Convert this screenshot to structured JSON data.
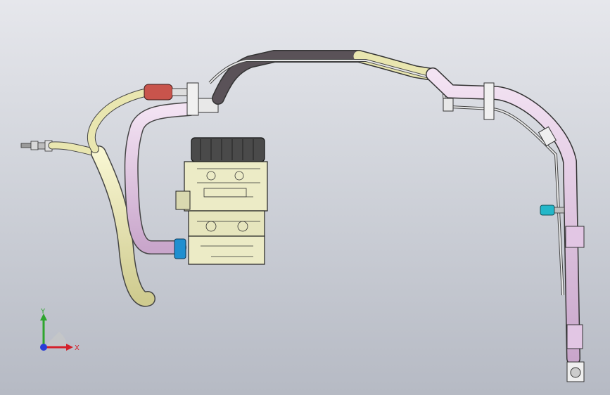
{
  "viewport": {
    "background_top": "#e6e7ec",
    "background_bottom": "#b6bac4"
  },
  "colors": {
    "hose_yellow": "#e9e6b0",
    "tube_pink": "#e2c6e4",
    "tube_dark": "#5a5258",
    "sleeve_red": "#c8544c",
    "fitting_blue": "#1f8fd0",
    "fitting_cyan": "#23b7c9",
    "compressor_body": "#ecebc6",
    "pulley": "#4a4a4a"
  },
  "parts": [
    {
      "name": "compressor",
      "icon": "compressor-icon"
    },
    {
      "name": "suction-hose",
      "icon": "hose-icon"
    },
    {
      "name": "discharge-hose",
      "icon": "hose-icon"
    },
    {
      "name": "liquid-line",
      "icon": "tube-icon"
    },
    {
      "name": "service-port",
      "icon": "valve-icon"
    }
  ],
  "triad": {
    "x_label": "X",
    "y_label": "Y",
    "x_color": "#d4202a",
    "y_color": "#2ea52e",
    "z_color": "#2a3dd6"
  }
}
